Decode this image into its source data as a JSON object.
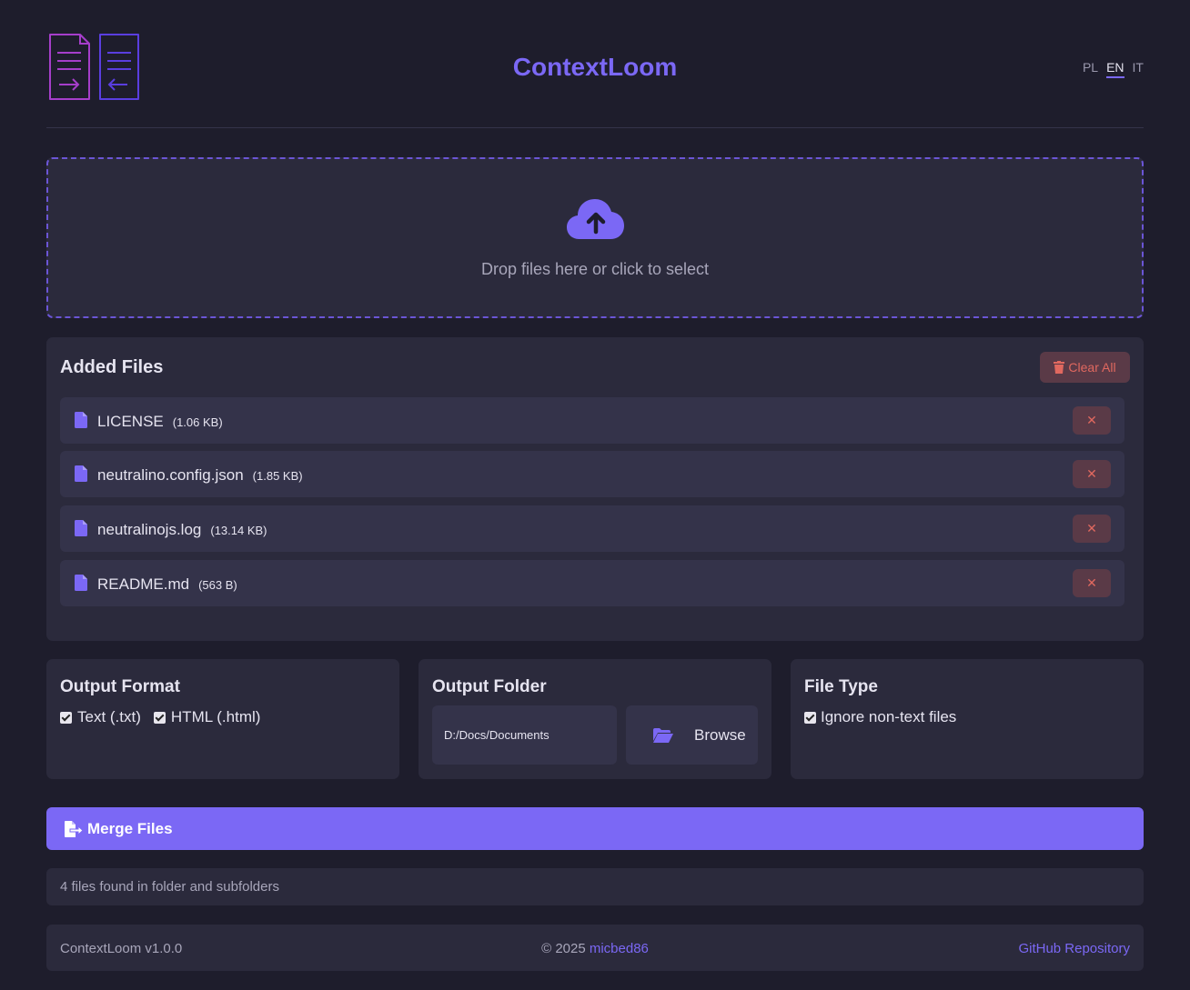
{
  "header": {
    "title": "ContextLoom",
    "languages": [
      "PL",
      "EN",
      "IT"
    ],
    "active_language": "EN"
  },
  "dropzone": {
    "icon": "cloud-upload-icon",
    "text": "Drop files here or click to select"
  },
  "files": {
    "title": "Added Files",
    "clear_all_label": "Clear All",
    "items": [
      {
        "name": "LICENSE",
        "size": "(1.06 KB)"
      },
      {
        "name": "neutralino.config.json",
        "size": "(1.85 KB)"
      },
      {
        "name": "neutralinojs.log",
        "size": "(13.14 KB)"
      },
      {
        "name": "README.md",
        "size": "(563 B)"
      }
    ],
    "remove_label": "✕"
  },
  "output_format": {
    "title": "Output Format",
    "options": [
      {
        "label": "Text (.txt)",
        "checked": true
      },
      {
        "label": "HTML (.html)",
        "checked": true
      }
    ]
  },
  "output_folder": {
    "title": "Output Folder",
    "path": "D:/Docs/Documents",
    "browse_label": "Browse"
  },
  "file_type": {
    "title": "File Type",
    "option": {
      "label": "Ignore non-text files",
      "checked": true
    }
  },
  "merge": {
    "label": "Merge Files"
  },
  "status": {
    "text": "4 files found in folder and subfolders"
  },
  "footer": {
    "version": "ContextLoom v1.0.0",
    "copyright": "© 2025",
    "author": "micbed86",
    "github": "GitHub Repository"
  },
  "colors": {
    "accent": "#7b68f5",
    "background": "#1e1d2c",
    "panel": "#2b2a3c",
    "danger": "#e0685f"
  }
}
